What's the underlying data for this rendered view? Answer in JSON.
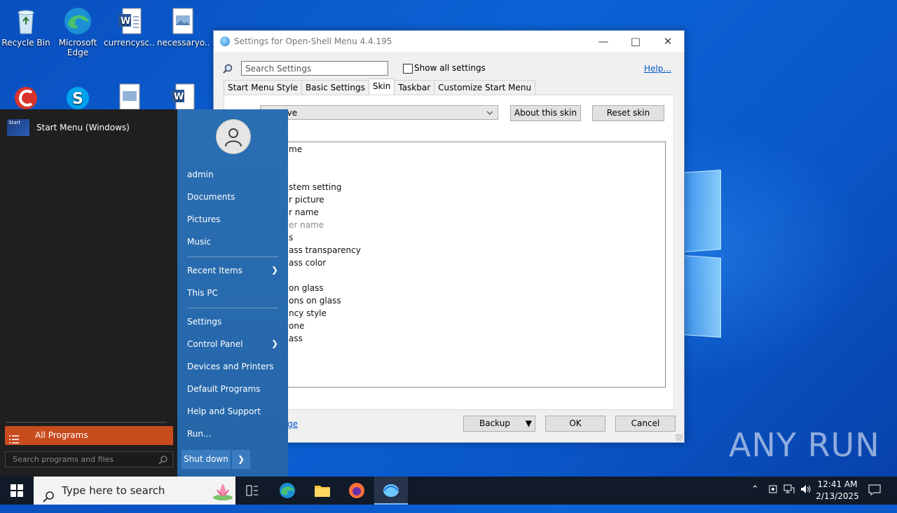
{
  "desktop": {
    "icons": [
      {
        "label": "Recycle Bin"
      },
      {
        "label": "Microsoft Edge"
      },
      {
        "label": "currencysc..."
      },
      {
        "label": "necessaryo..."
      }
    ]
  },
  "settings_window": {
    "title": "Settings for Open-Shell Menu 4.4.195",
    "search_placeholder": "Search Settings",
    "show_all_label": "Show all settings",
    "help_label": "Help...",
    "tabs": [
      "Start Menu Style",
      "Basic Settings",
      "Skin",
      "Taskbar",
      "Customize Start Menu"
    ],
    "active_tab": "Skin",
    "skin_value": "sive",
    "about_skin_label": "About this skin",
    "reset_skin_label": "Reset skin",
    "options": [
      "me",
      "stem setting",
      "r picture",
      "r name",
      "er name",
      "s",
      "ass transparency",
      "ass color",
      "on glass",
      "ons on glass",
      "ncy style",
      "one",
      "ass"
    ],
    "home_link": "page",
    "backup_label": "Backup",
    "ok_label": "OK",
    "cancel_label": "Cancel"
  },
  "start_menu": {
    "pinned_item": "Start Menu (Windows)",
    "pinned_icon_text": "Start",
    "all_programs_label": "All Programs",
    "search_placeholder": "Search programs and files",
    "right_items": [
      {
        "label": "admin"
      },
      {
        "label": "Documents"
      },
      {
        "label": "Pictures"
      },
      {
        "label": "Music"
      },
      {
        "label": "Recent Items"
      },
      {
        "label": "This PC"
      },
      {
        "label": "Settings"
      },
      {
        "label": "Control Panel"
      },
      {
        "label": "Devices and Printers"
      },
      {
        "label": "Default Programs"
      },
      {
        "label": "Help and Support"
      },
      {
        "label": "Run..."
      }
    ],
    "shutdown_label": "Shut down"
  },
  "taskbar": {
    "search_placeholder": "Type here to search",
    "time": "12:41 AM",
    "date": "2/13/2025"
  },
  "watermark": "ANY RUN",
  "colors": {
    "desktop_blue": "#0b63d6",
    "start_right": "#2a6eb3",
    "all_programs": "#c84b1e",
    "taskbar": "#101a28"
  }
}
